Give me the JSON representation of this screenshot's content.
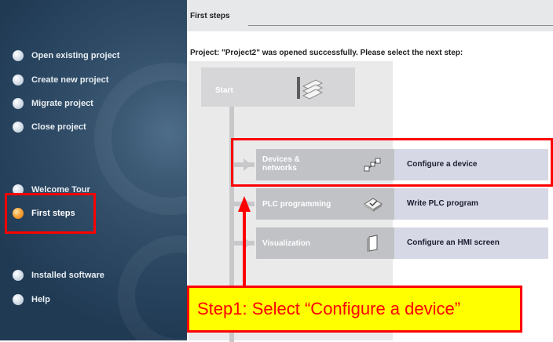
{
  "sidebar": {
    "items": [
      {
        "label": "Open existing project"
      },
      {
        "label": "Create new project"
      },
      {
        "label": "Migrate project"
      },
      {
        "label": "Close project"
      },
      {
        "label": "Welcome Tour"
      },
      {
        "label": "First steps"
      },
      {
        "label": "Installed software"
      },
      {
        "label": "Help"
      }
    ]
  },
  "main": {
    "title": "First steps",
    "subtitle": "Project: \"Project2\" was opened successfully. Please select the next step:",
    "start_label": "Start",
    "steps": [
      {
        "label": "Devices &\nnetworks",
        "action": "Configure a device",
        "icon": "devices-networks-icon"
      },
      {
        "label": "PLC programming",
        "action": "Write PLC program",
        "icon": "plc-programming-icon"
      },
      {
        "label": "Visualization",
        "action": "Configure an HMI screen",
        "icon": "visualization-icon"
      }
    ]
  },
  "annotation": {
    "callout_text": "Step1: Select “Configure a device”",
    "color": "#ff0000",
    "callout_bg": "#ffff00"
  },
  "colors": {
    "sidebar_bg": "#2f4b66",
    "active_dot": "#f9a63a",
    "step_bg": "#c1c2c6",
    "action_bg": "#d7d8e6"
  }
}
